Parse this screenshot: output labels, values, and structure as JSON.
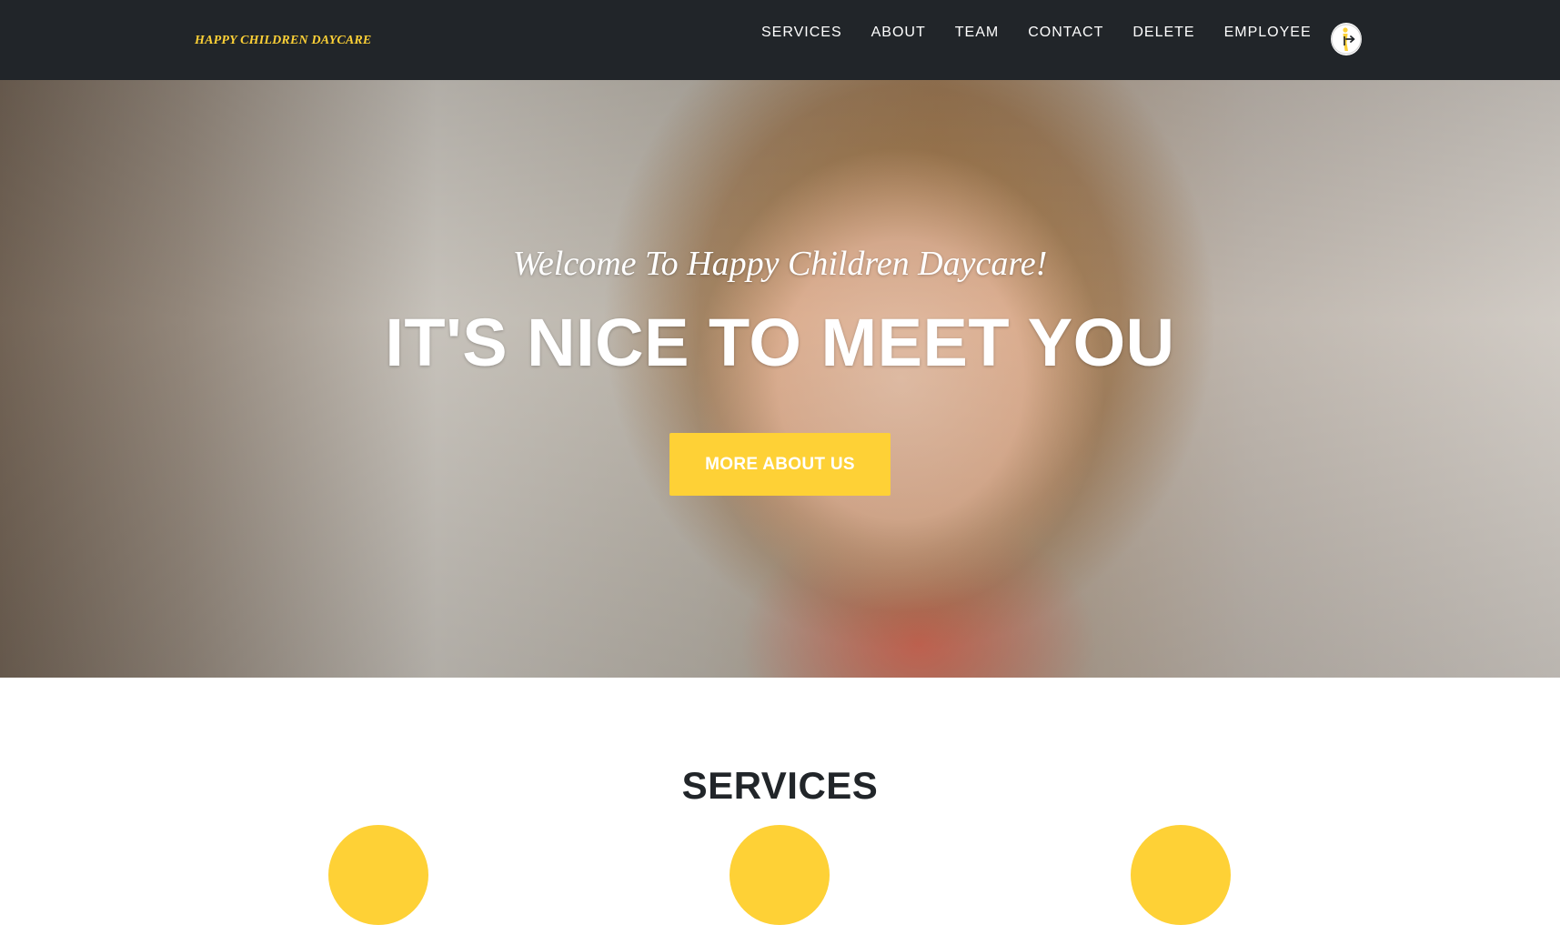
{
  "navbar": {
    "brand": "HAPPY CHILDREN DAYCARE",
    "links": [
      {
        "label": "SERVICES"
      },
      {
        "label": "ABOUT"
      },
      {
        "label": "TEAM"
      },
      {
        "label": "CONTACT"
      },
      {
        "label": "DELETE"
      },
      {
        "label": "EMPLOYEE"
      }
    ],
    "logout_icon": "logout-person-icon"
  },
  "hero": {
    "lead": "Welcome To Happy Children Daycare!",
    "heading": "IT'S NICE TO MEET YOU",
    "button_label": "MORE ABOUT US"
  },
  "services": {
    "heading": "SERVICES"
  },
  "colors": {
    "navbar_bg": "#212529",
    "accent": "#fed136",
    "text_dark": "#212529",
    "white": "#ffffff"
  }
}
